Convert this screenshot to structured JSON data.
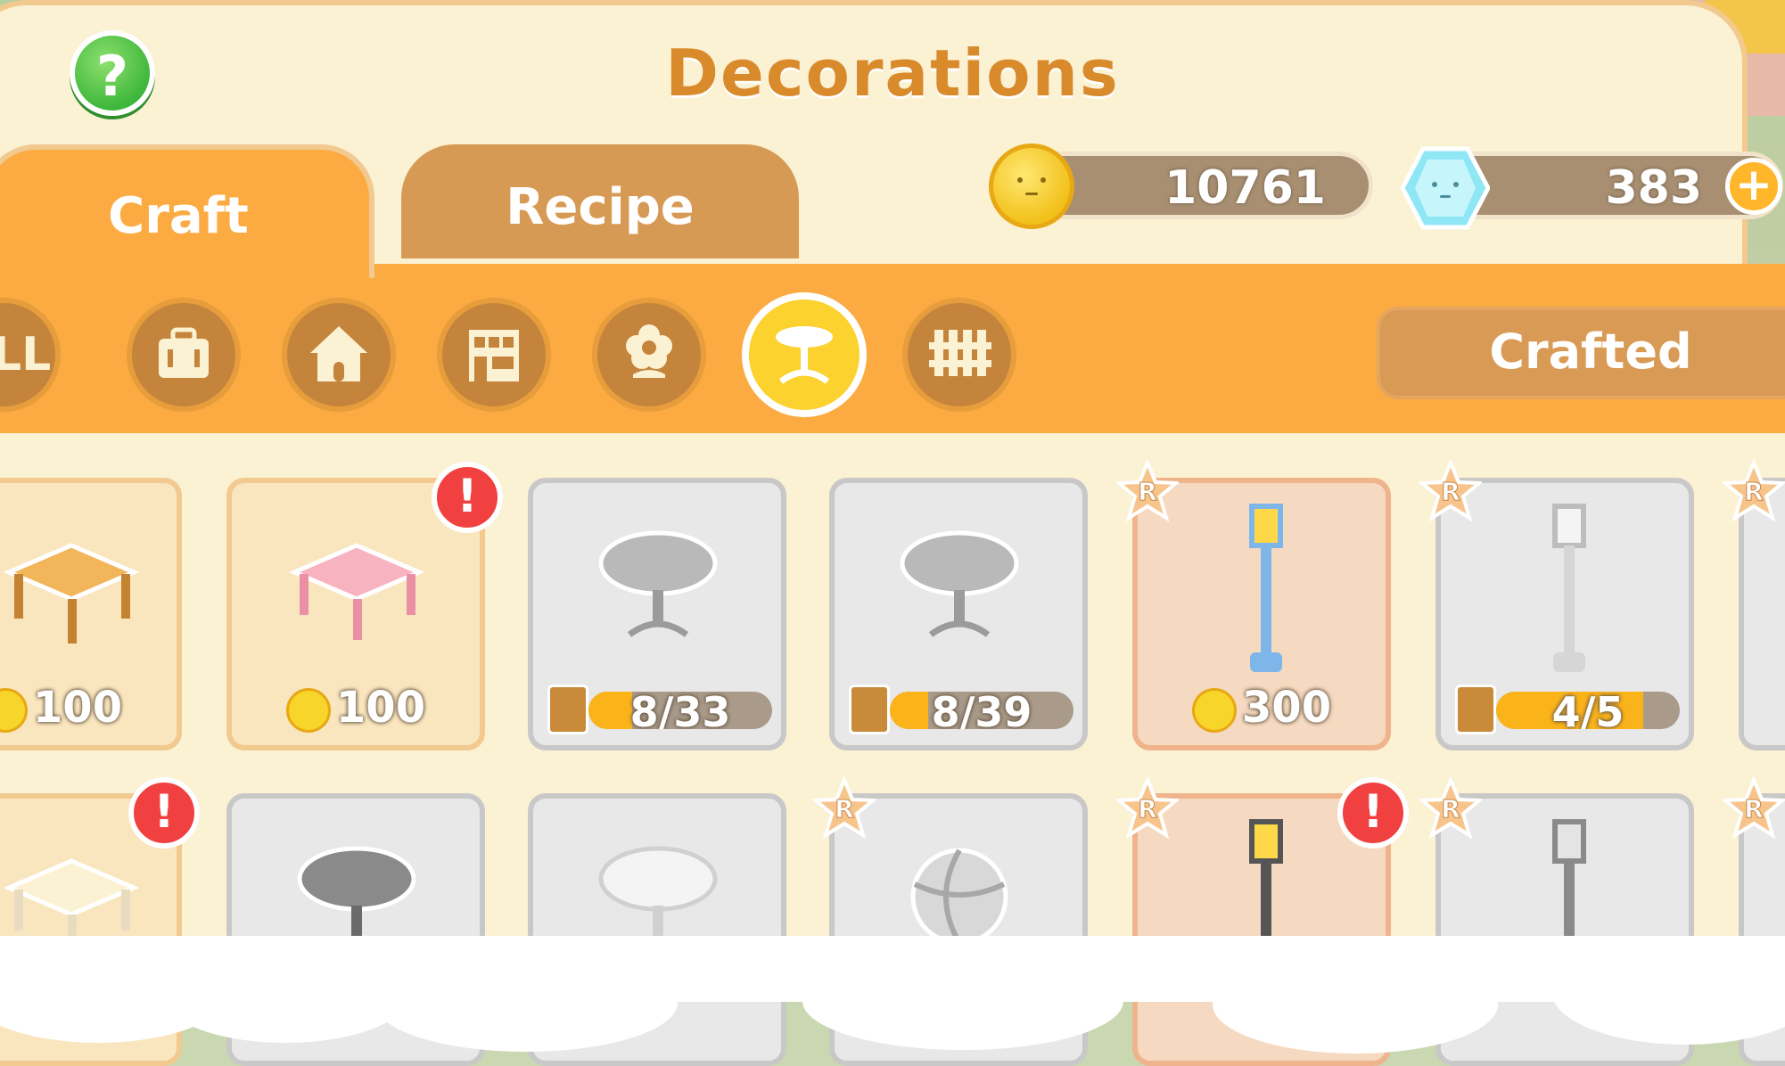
{
  "window": {
    "title": "Decorations"
  },
  "help_button": {
    "label": "?"
  },
  "tabs": [
    {
      "label": "Craft",
      "active": true
    },
    {
      "label": "Recipe",
      "active": false
    }
  ],
  "currency": {
    "coins": "10761",
    "gems": "383",
    "gem_plus": "+"
  },
  "categories": [
    {
      "label": "ALL",
      "icon": "all-label"
    },
    {
      "icon": "suitcase-icon"
    },
    {
      "icon": "house-icon"
    },
    {
      "icon": "shop-building-icon"
    },
    {
      "icon": "flower-icon"
    },
    {
      "icon": "table-icon",
      "selected": true
    },
    {
      "icon": "fence-icon"
    }
  ],
  "crafted_button": {
    "label": "Crafted"
  },
  "items_row1": [
    {
      "name": "wooden-table",
      "price": "100",
      "state": "craftable"
    },
    {
      "name": "pink-table",
      "price": "100",
      "state": "craftable",
      "alert": "!"
    },
    {
      "name": "round-table-grey",
      "progress": "8/33",
      "progress_fraction": 0.24,
      "state": "locked"
    },
    {
      "name": "round-table-grey-2",
      "progress": "8/39",
      "progress_fraction": 0.21,
      "state": "locked"
    },
    {
      "name": "blue-street-lamp",
      "price": "300",
      "state": "rare",
      "rare_label": "R"
    },
    {
      "name": "white-street-lamp",
      "progress": "4/5",
      "progress_fraction": 0.8,
      "state": "locked-rare",
      "rare_label": "R"
    }
  ],
  "items_row2": [
    {
      "name": "cream-table",
      "state": "craftable",
      "alert": "!"
    },
    {
      "name": "dark-round-table",
      "state": "locked"
    },
    {
      "name": "white-round-table",
      "state": "locked"
    },
    {
      "name": "beach-ball",
      "state": "locked-rare",
      "rare_label": "R"
    },
    {
      "name": "black-street-lamp",
      "state": "rare",
      "rare_label": "R",
      "alert": "!"
    },
    {
      "name": "grey-street-lamp",
      "state": "locked-rare",
      "rare_label": "R"
    }
  ],
  "colors": {
    "panel": "#fbf1d3",
    "accent_orange": "#fbab42",
    "title_orange": "#d98a2b",
    "alert_red": "#f04040",
    "coin_gold": "#f8d52a"
  }
}
